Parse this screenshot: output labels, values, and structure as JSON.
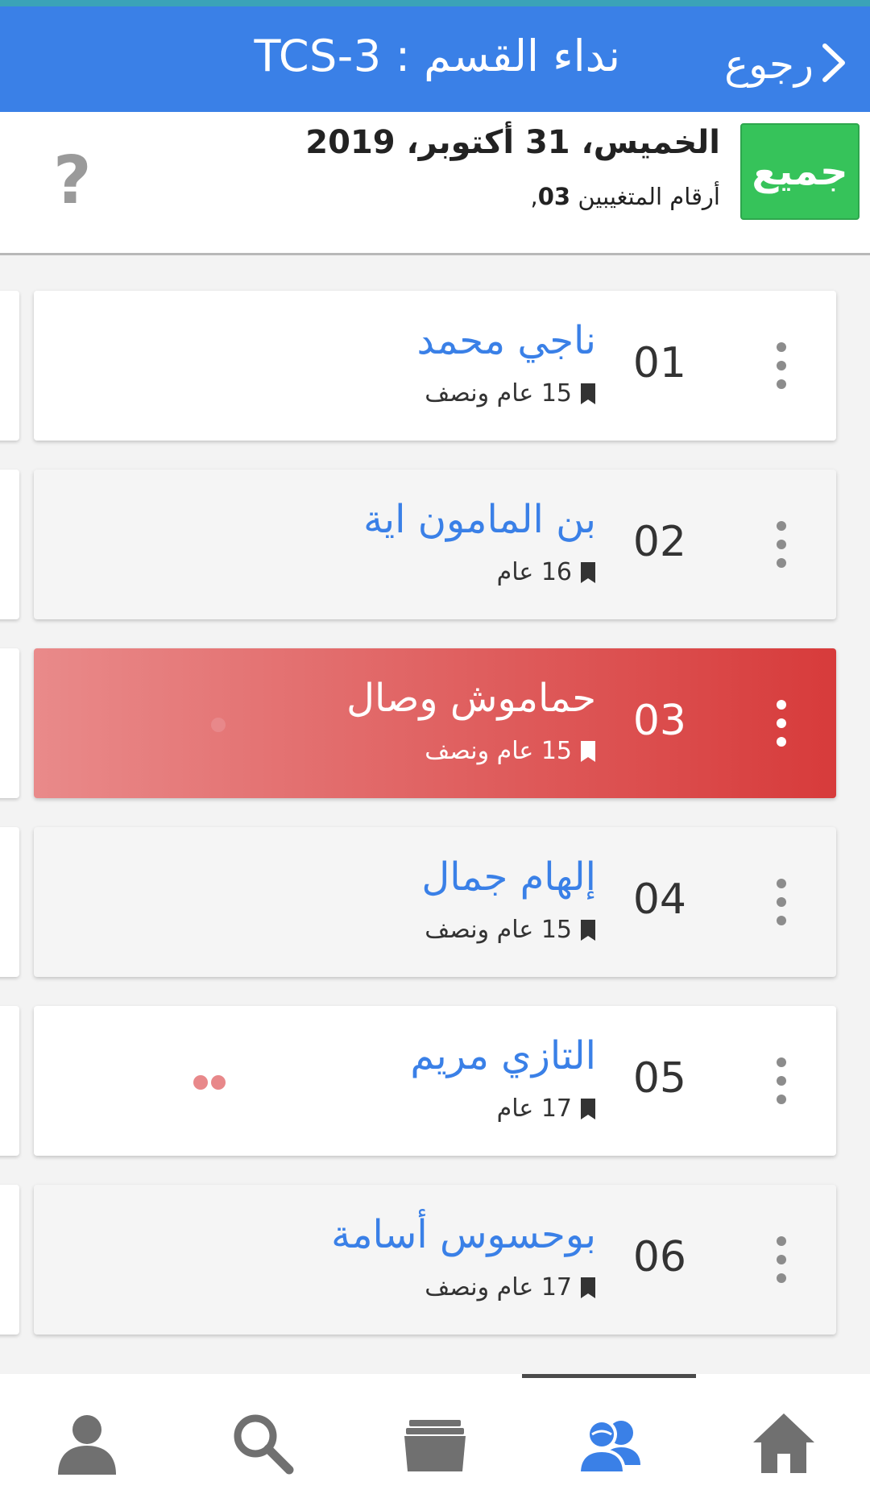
{
  "header": {
    "title": "نداء القسم : TCS-3",
    "back_label": "رجوع"
  },
  "subbar": {
    "all_button": "جميع",
    "date": "الخميس، 31 أكتوبر، 2019",
    "absent_prefix": "أرقام المتغيبين ",
    "absent_numbers": "03",
    "absent_suffix": ",",
    "help": "?"
  },
  "students": [
    {
      "num": "01",
      "name": "ناجي محمد",
      "age": "15 عام ونصف",
      "status": "present"
    },
    {
      "num": "02",
      "name": "بن المامون اية",
      "age": "16 عام",
      "status": "present"
    },
    {
      "num": "03",
      "name": "حماموش وصال",
      "age": "15 عام ونصف",
      "status": "absent"
    },
    {
      "num": "04",
      "name": "إلهام جمال",
      "age": "15 عام ونصف",
      "status": "present"
    },
    {
      "num": "05",
      "name": "التازي مريم",
      "age": "17 عام",
      "status": "present"
    },
    {
      "num": "06",
      "name": "بوحسوس أسامة",
      "age": "17 عام ونصف",
      "status": "present"
    }
  ],
  "bottom_nav": [
    "profile-icon",
    "search-icon",
    "folder-icon",
    "students-icon",
    "home-icon"
  ],
  "colors": {
    "header": "#3a80e7",
    "all_button": "#36c35a",
    "absent_card": "#d73b3b",
    "dot": "#e8888a",
    "active_tab": "#3a80e7",
    "inactive_tab": "#707070"
  }
}
